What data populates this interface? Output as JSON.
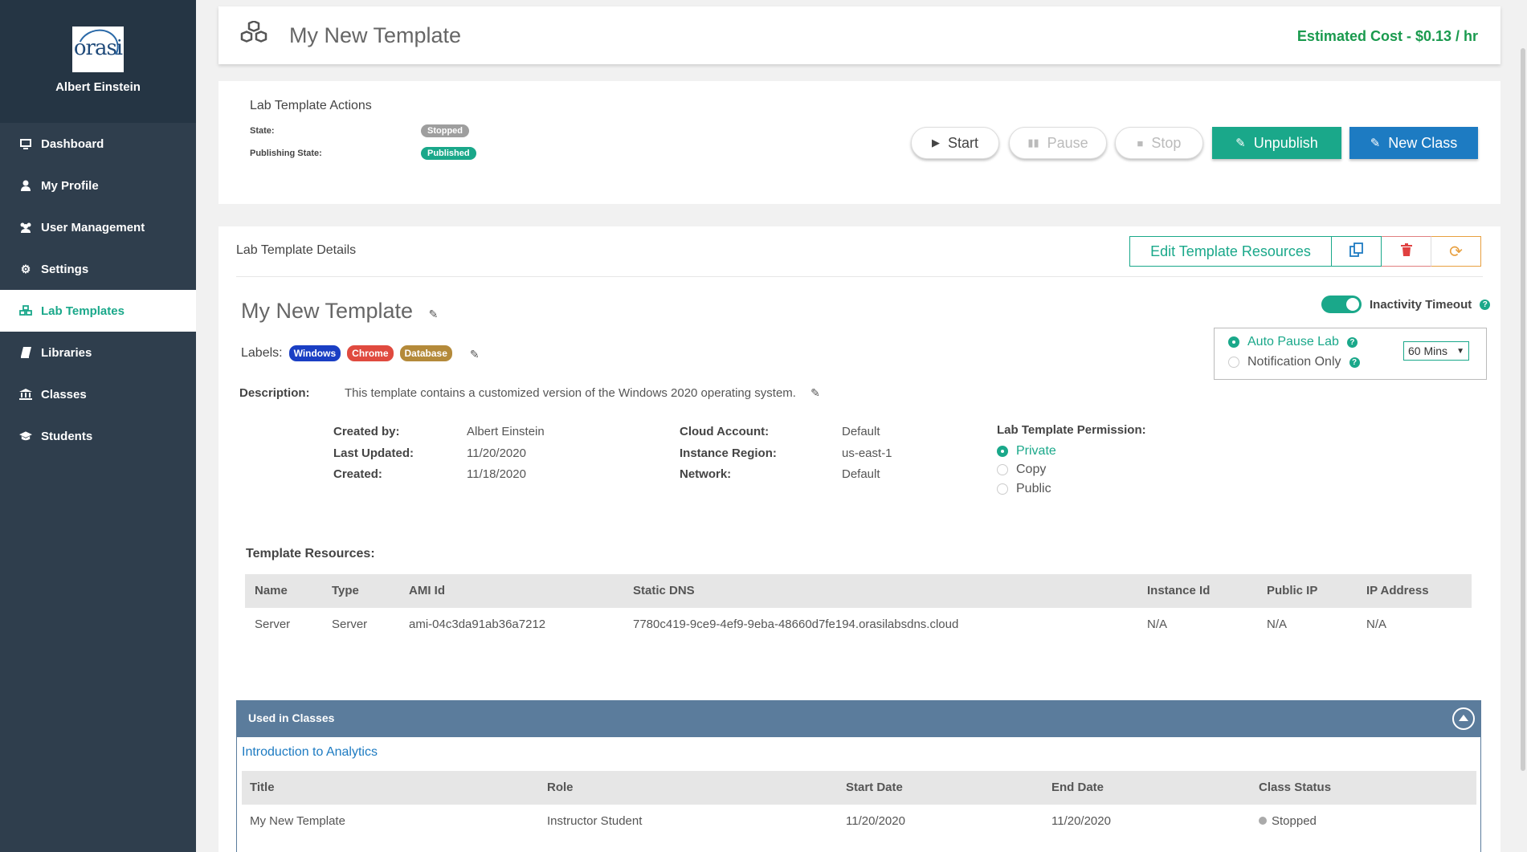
{
  "sidebar": {
    "logo_text": "orasi",
    "user": "Albert Einstein",
    "items": [
      {
        "label": "Dashboard",
        "icon": "monitor-icon"
      },
      {
        "label": "My Profile",
        "icon": "user-icon"
      },
      {
        "label": "User Management",
        "icon": "users-icon"
      },
      {
        "label": "Settings",
        "icon": "gear-icon"
      },
      {
        "label": "Lab Templates",
        "icon": "cubes-icon"
      },
      {
        "label": "Libraries",
        "icon": "book-icon"
      },
      {
        "label": "Classes",
        "icon": "bank-icon"
      },
      {
        "label": "Students",
        "icon": "graduation-cap-icon"
      }
    ],
    "active_color": "#1aa88a",
    "bg_color": "#2f3e4d"
  },
  "header": {
    "title": "My New Template",
    "cost": "Estimated Cost - $0.13 / hr"
  },
  "actions": {
    "title": "Lab Template Actions",
    "state_label": "State:",
    "state_value": "Stopped",
    "publishing_label": "Publishing State:",
    "publishing_value": "Published",
    "start": "Start",
    "pause": "Pause",
    "stop": "Stop",
    "unpublish": "Unpublish",
    "new_class": "New Class"
  },
  "details": {
    "title": "Lab Template Details",
    "edit_resources": "Edit Template Resources",
    "name": "My New Template",
    "labels_label": "Labels:",
    "labels": [
      {
        "text": "Windows",
        "color": "#1a3fc4"
      },
      {
        "text": "Chrome",
        "color": "#e04a3f"
      },
      {
        "text": "Database",
        "color": "#b48a3a"
      }
    ],
    "description_label": "Description:",
    "description": "This template contains a customized version of the Windows 2020 operating system.",
    "meta": {
      "created_by_k": "Created by:",
      "created_by_v": "Albert Einstein",
      "last_updated_k": "Last Updated:",
      "last_updated_v": "11/20/2020",
      "created_k": "Created:",
      "created_v": "11/18/2020",
      "cloud_account_k": "Cloud Account:",
      "cloud_account_v": "Default",
      "instance_region_k": "Instance Region:",
      "instance_region_v": "us-east-1",
      "network_k": "Network:",
      "network_v": "Default"
    },
    "permission": {
      "title": "Lab Template Permission:",
      "options": [
        "Private",
        "Copy",
        "Public"
      ],
      "selected": "Private"
    },
    "inactivity": {
      "label": "Inactivity Timeout",
      "enabled": true,
      "auto_pause": "Auto Pause Lab",
      "notification_only": "Notification Only",
      "selected": "Auto Pause Lab",
      "duration": "60 Mins"
    }
  },
  "resources": {
    "title": "Template Resources:",
    "columns": [
      "Name",
      "Type",
      "AMI Id",
      "Static DNS",
      "Instance Id",
      "Public IP",
      "IP Address"
    ],
    "rows": [
      [
        "Server",
        "Server",
        "ami-04c3da91ab36a7212",
        "7780c419-9ce9-4ef9-9eba-48660d7fe194.orasilabsdns.cloud",
        "N/A",
        "N/A",
        "N/A"
      ]
    ]
  },
  "classes": {
    "title": "Used in Classes",
    "class_link": "Introduction to Analytics",
    "columns": [
      "Title",
      "Role",
      "Start Date",
      "End Date",
      "Class Status"
    ],
    "rows": [
      [
        "My New Template",
        "Instructor Student",
        "11/20/2020",
        "11/20/2020",
        "Stopped"
      ]
    ]
  }
}
